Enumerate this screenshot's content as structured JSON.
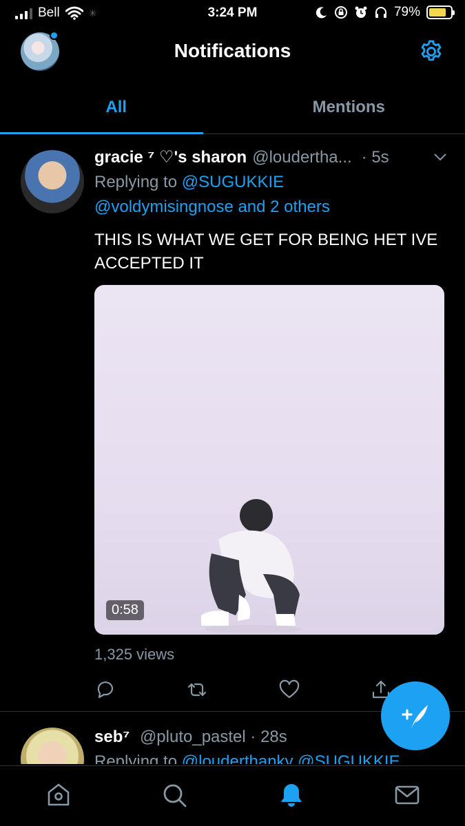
{
  "status_bar": {
    "carrier": "Bell",
    "time": "3:24 PM",
    "battery": "79%"
  },
  "header": {
    "title": "Notifications"
  },
  "tabs": [
    {
      "label": "All",
      "active": true
    },
    {
      "label": "Mentions",
      "active": false
    }
  ],
  "tweet": {
    "name": "gracie ⁷ ♡'s sharon",
    "handle": "@loudertha...",
    "time": "· 5s",
    "replying_prefix": "Replying to",
    "replying_to_1": "@SUGUKKIE",
    "replying_to_2": "@voldymisingnose and 2 others",
    "text": "THIS IS WHAT WE GET FOR BEING HET IVE ACCEPTED IT",
    "media_duration": "0:58",
    "views": "1,325 views"
  },
  "tweet2": {
    "name": "seb⁷",
    "handle": "@pluto_pastel",
    "time": "· 28s",
    "replying_prefix": "Replying to",
    "replying_to": "@louderthanky @SUGUKKIE"
  },
  "colors": {
    "accent": "#1da1f2",
    "muted": "#8899a6",
    "background": "#000000"
  }
}
